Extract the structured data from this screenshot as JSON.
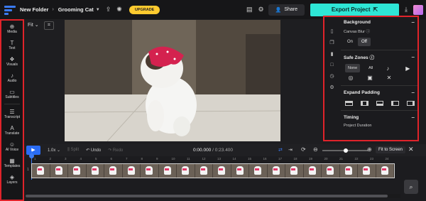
{
  "topbar": {
    "breadcrumb_root": "New Folder",
    "breadcrumb_sep": "›",
    "project_name": "Grooming Cat",
    "upgrade_label": "UPGRADE",
    "share_label": "Share",
    "export_label": "Export Project"
  },
  "sidebar": {
    "items": [
      {
        "label": "Media",
        "icon": "media-icon"
      },
      {
        "label": "Text",
        "icon": "text-icon"
      },
      {
        "label": "Visuals",
        "icon": "visuals-icon"
      },
      {
        "label": "Audio",
        "icon": "audio-icon"
      },
      {
        "label": "Subtitles",
        "icon": "subtitles-icon"
      },
      {
        "label": "Transcript",
        "icon": "transcript-icon"
      },
      {
        "label": "Translate",
        "icon": "translate-icon"
      },
      {
        "label": "AI Voice",
        "icon": "ai-voice-icon"
      },
      {
        "label": "Templates",
        "icon": "templates-icon"
      },
      {
        "label": "Layers",
        "icon": "layers-icon"
      }
    ]
  },
  "canvas": {
    "fit_label": "Fit"
  },
  "panel": {
    "background": {
      "title": "Background",
      "blur_label": "Canvas Blur",
      "on": "On",
      "off": "Off",
      "selected": "Off"
    },
    "safe_zones": {
      "title": "Safe Zones",
      "none": "None",
      "all": "All"
    },
    "expand_padding": {
      "title": "Expand Padding"
    },
    "timing": {
      "title": "Timing",
      "duration_label": "Project Duration"
    }
  },
  "transport": {
    "speed": "1.0x",
    "split": "Split",
    "undo": "Undo",
    "redo": "Redo",
    "current_time": "0:00.000",
    "total_time": "/ 0:23.400",
    "fit_to_screen": "Fit to Screen",
    "zoom_level": 0.5
  },
  "ruler_labels": [
    "1",
    "2",
    "3",
    "4",
    "5",
    "6",
    "7",
    "8",
    "9",
    "10",
    "11",
    "12",
    "13",
    "14",
    "15",
    "16",
    "17",
    "18",
    "19",
    "20",
    "21",
    "22",
    "23",
    "24"
  ],
  "track": {
    "number": "1",
    "frame_count": 20
  },
  "colors": {
    "accent": "#2a6cf5",
    "export": "#2ee6d6",
    "upgrade": "#ffcb2f",
    "highlight": "#e0232a"
  }
}
